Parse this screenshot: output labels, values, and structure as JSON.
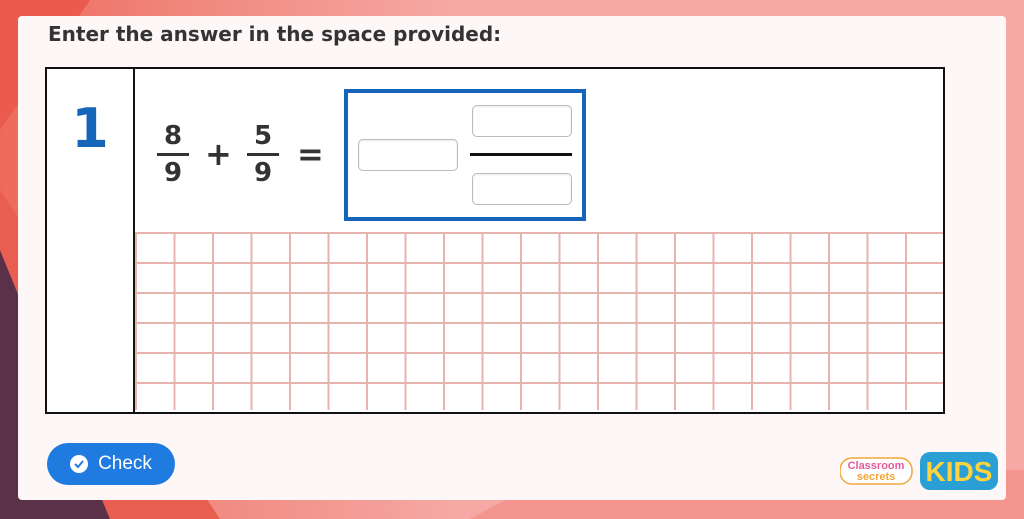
{
  "instruction": "Enter the answer in the space provided:",
  "question": {
    "number": "1",
    "fraction_a": {
      "numerator": "8",
      "denominator": "9"
    },
    "operator": "+",
    "fraction_b": {
      "numerator": "5",
      "denominator": "9"
    },
    "equals": "=",
    "answer": {
      "whole": "",
      "numerator": "",
      "denominator": ""
    }
  },
  "check_button": {
    "label": "Check",
    "icon": "check-circle-icon"
  },
  "logo": {
    "line1": "Classroom",
    "line2": "secrets",
    "badge": "KIDS"
  },
  "colors": {
    "accent": "#1565b8",
    "button": "#1f7be0",
    "grid": "#e6b3ad"
  }
}
